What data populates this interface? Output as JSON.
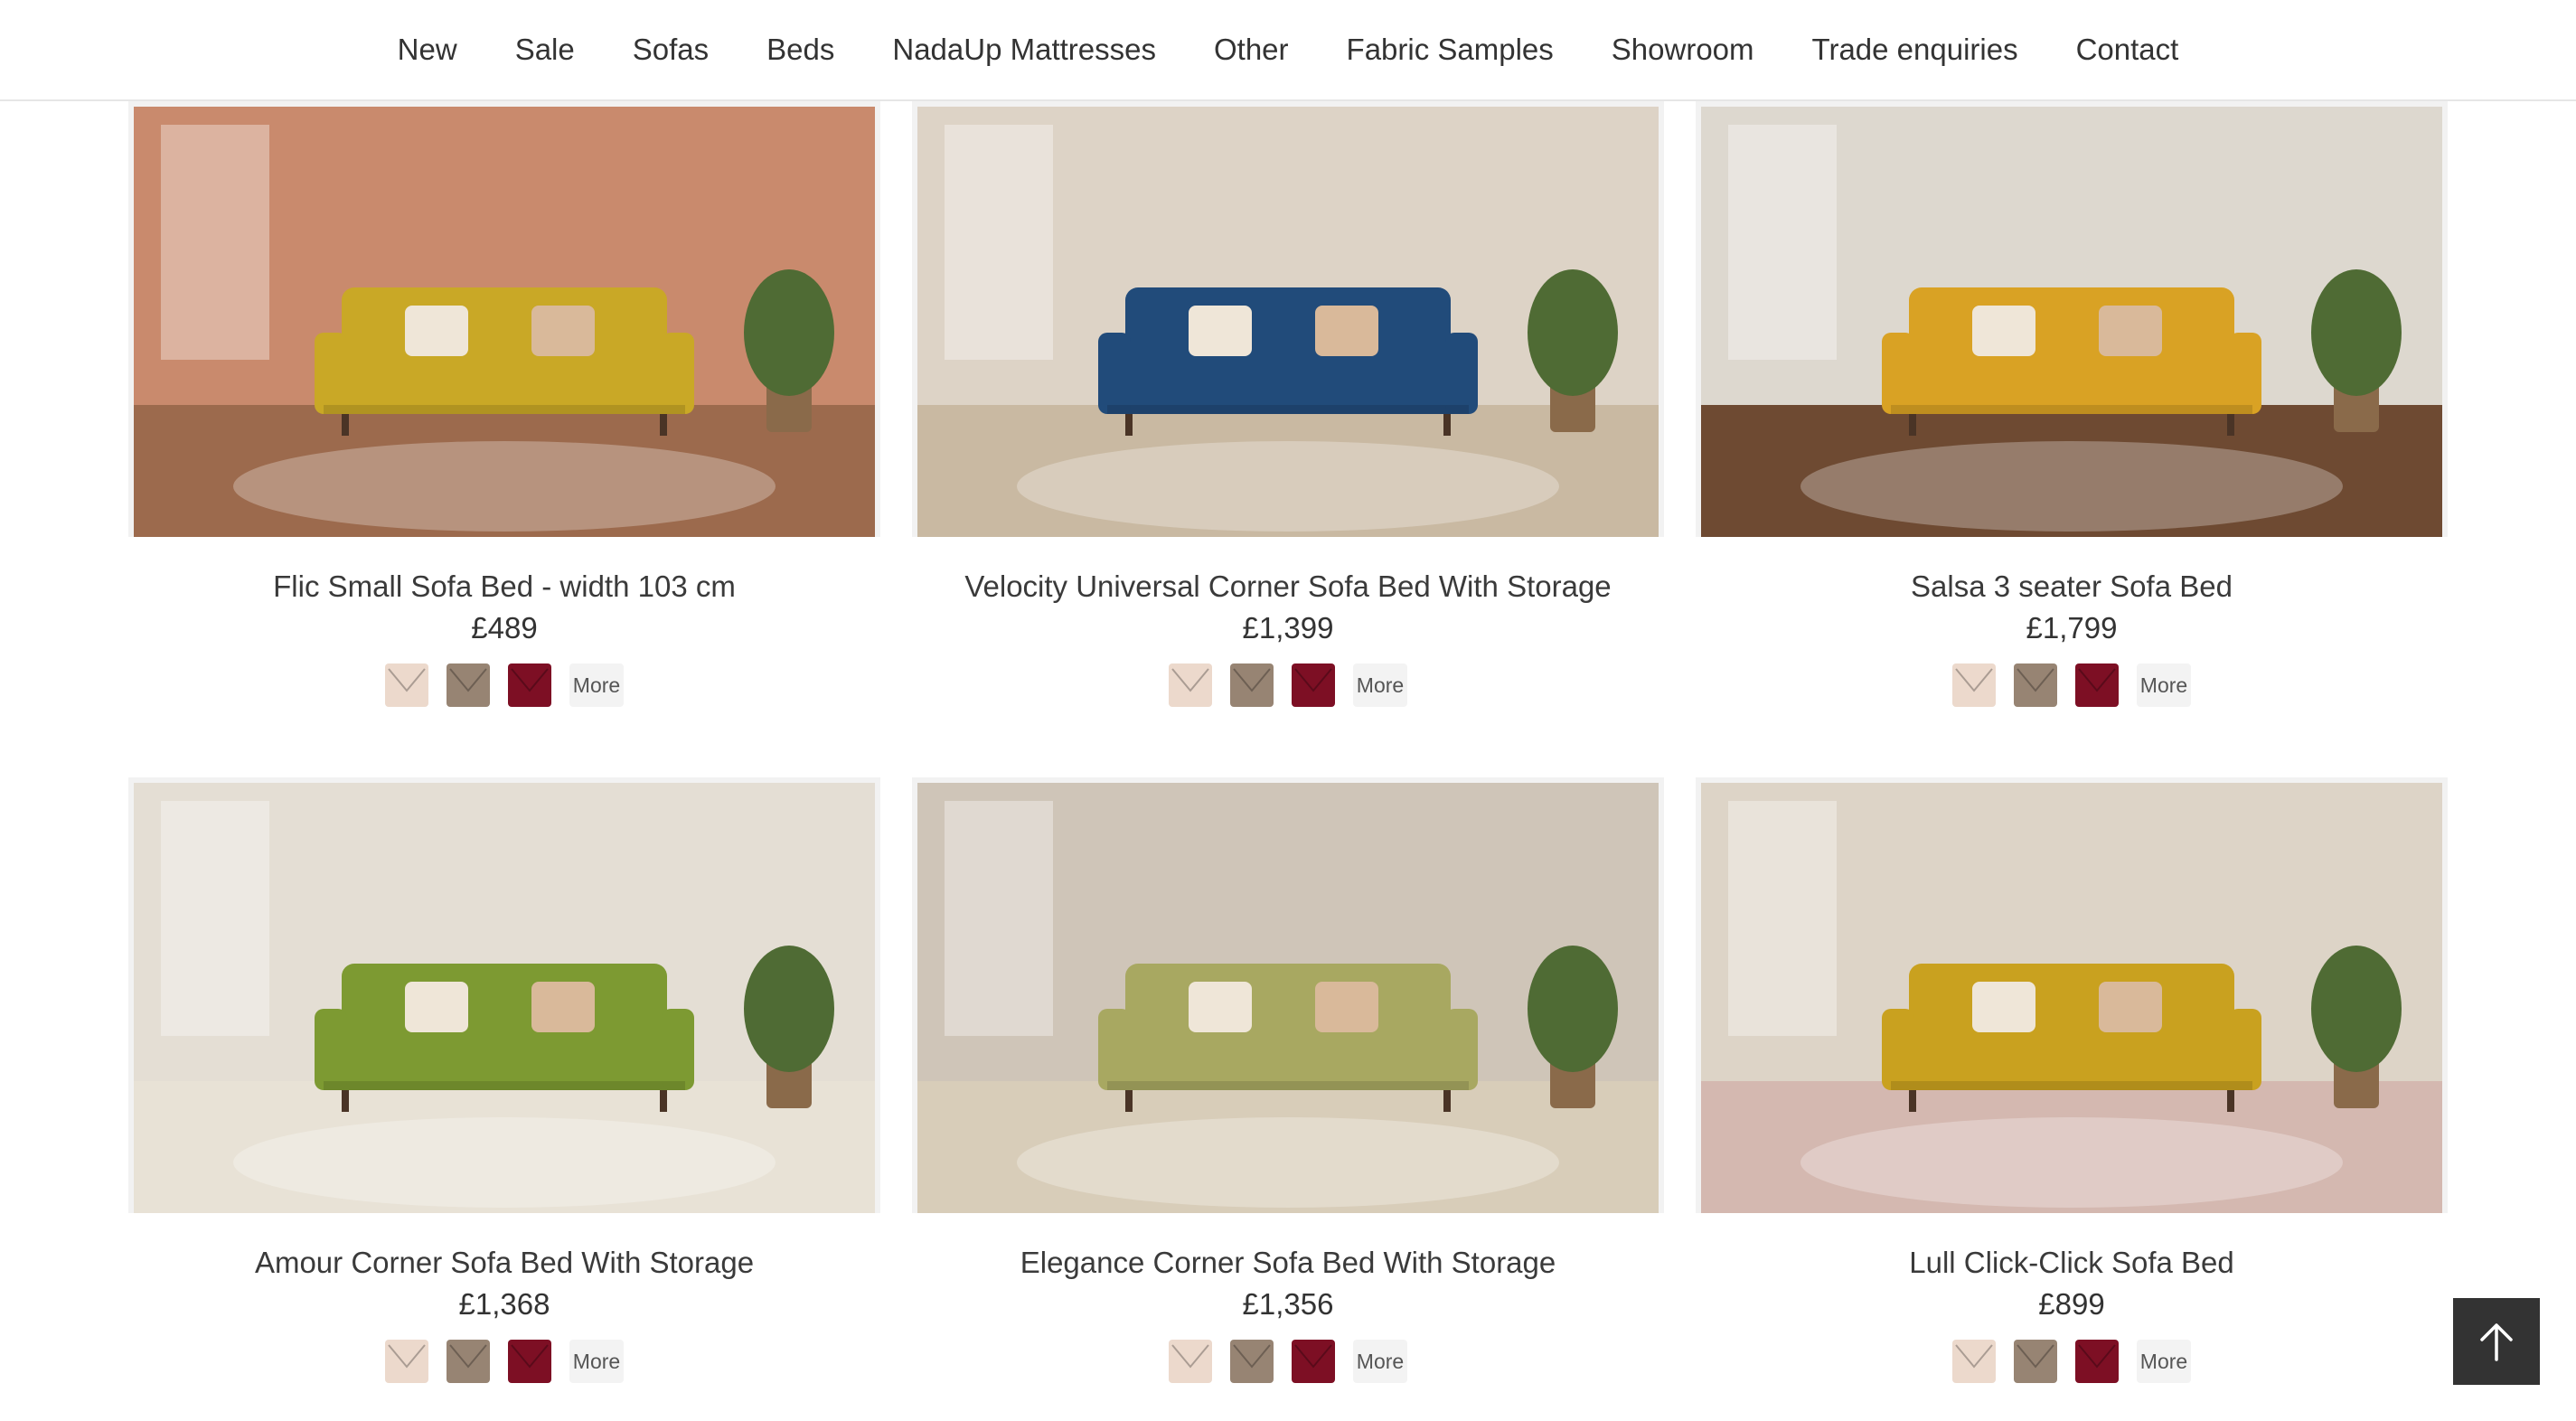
{
  "nav": {
    "items": [
      "New",
      "Sale",
      "Sofas",
      "Beds",
      "NadaUp Mattresses",
      "Other",
      "Fabric Samples",
      "Showroom",
      "Trade enquiries",
      "Contact"
    ]
  },
  "swatch_colors": [
    "#ecd9cc",
    "#978473",
    "#7d0f24"
  ],
  "products": [
    {
      "title": "Flic Small Sofa Bed - width 103 cm",
      "price": "£489",
      "more": "More",
      "sofa_color": "#c9a826",
      "wall_color": "#c98a6d",
      "floor_color": "#9c6a4d"
    },
    {
      "title": "Velocity Universal Corner Sofa Bed With Storage",
      "price": "£1,399",
      "more": "More",
      "sofa_color": "#214b7a",
      "wall_color": "#ddd3c6",
      "floor_color": "#c9b9a2"
    },
    {
      "title": "Salsa 3 seater Sofa Bed",
      "price": "£1,799",
      "more": "More",
      "sofa_color": "#d9a224",
      "wall_color": "#ddd8cf",
      "floor_color": "#6e4a32"
    },
    {
      "title": "Amour Corner Sofa Bed With Storage",
      "price": "£1,368",
      "more": "More",
      "sofa_color": "#7d9a32",
      "wall_color": "#e4ded4",
      "floor_color": "#e8e2d6"
    },
    {
      "title": "Elegance Corner Sofa Bed With Storage",
      "price": "£1,356",
      "more": "More",
      "sofa_color": "#a8a861",
      "wall_color": "#cfc5b8",
      "floor_color": "#d8cdb9"
    },
    {
      "title": "Lull Click-Click Sofa Bed",
      "price": "£899",
      "more": "More",
      "sofa_color": "#c9a11f",
      "wall_color": "#ddd4c7",
      "floor_color": "#d4b8b0"
    }
  ]
}
